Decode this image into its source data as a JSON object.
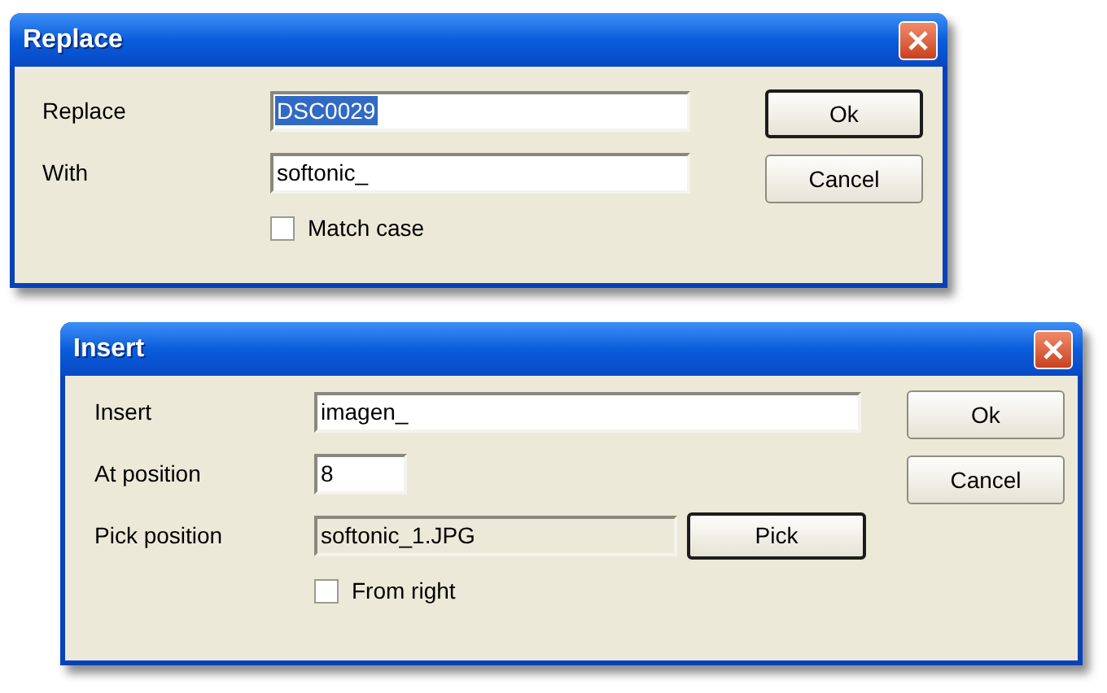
{
  "dialogs": [
    {
      "title": "Replace",
      "rows": [
        {
          "label": "Replace",
          "kind": "text",
          "value": "DSC0029",
          "selected": true
        },
        {
          "label": "With",
          "kind": "text",
          "value": "softonic_",
          "selected": false
        }
      ],
      "checkbox": {
        "label": "Match case",
        "checked": false
      },
      "buttons": [
        {
          "label": "Ok",
          "default": true
        },
        {
          "label": "Cancel",
          "default": false
        }
      ]
    },
    {
      "title": "Insert",
      "rows": [
        {
          "label": "Insert",
          "kind": "text",
          "value": "imagen_",
          "selected": false
        },
        {
          "label": "At position",
          "kind": "number",
          "value": "8",
          "selected": false
        },
        {
          "label": "Pick position",
          "kind": "picker",
          "value": "softonic_1.JPG",
          "button": {
            "label": "Pick",
            "default": true
          }
        }
      ],
      "checkbox": {
        "label": "From right",
        "checked": false
      },
      "buttons": [
        {
          "label": "Ok",
          "default": false
        },
        {
          "label": "Cancel",
          "default": false
        }
      ]
    }
  ]
}
